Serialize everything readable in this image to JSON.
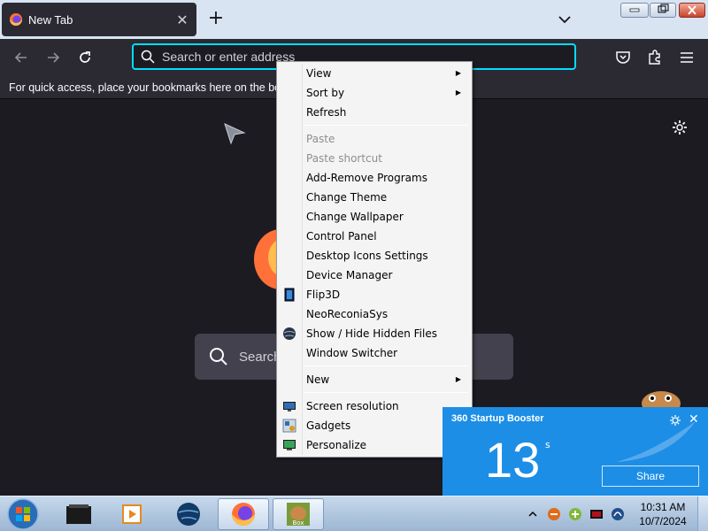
{
  "browser": {
    "tab": {
      "title": "New Tab",
      "favicon": "firefox-icon",
      "close_icon": "close-icon"
    },
    "new_tab_icon": "plus-icon",
    "tab_list_icon": "chevron-down-icon",
    "window_controls": [
      "minimize-icon",
      "maximize-icon",
      "close-icon"
    ],
    "nav": {
      "back_icon": "back-arrow-icon",
      "forward_icon": "forward-arrow-icon",
      "reload_icon": "reload-icon"
    },
    "urlbar": {
      "placeholder": "Search or enter address",
      "search_icon": "search-icon"
    },
    "toolbar_icons": [
      "pocket-icon",
      "extensions-icon",
      "menu-icon"
    ],
    "bookmarks_bar_text": "For quick access, place your bookmarks here on the bookmarks toolbar.",
    "content": {
      "search_placeholder": "Search",
      "settings_icon": "gear-icon"
    },
    "accent": "#00ddff"
  },
  "context_menu": {
    "items": [
      {
        "label": "View",
        "submenu": true,
        "enabled": true
      },
      {
        "label": "Sort by",
        "submenu": true,
        "enabled": true
      },
      {
        "label": "Refresh",
        "enabled": true
      },
      {
        "separator": true
      },
      {
        "label": "Paste",
        "enabled": false
      },
      {
        "label": "Paste shortcut",
        "enabled": false
      },
      {
        "label": "Add-Remove Programs",
        "enabled": true
      },
      {
        "label": "Change Theme",
        "enabled": true
      },
      {
        "label": "Change Wallpaper",
        "enabled": true
      },
      {
        "label": "Control Panel",
        "enabled": true
      },
      {
        "label": "Desktop Icons Settings",
        "enabled": true
      },
      {
        "label": "Device Manager",
        "enabled": true
      },
      {
        "label": "Flip3D",
        "enabled": true,
        "icon": "flip3d-icon"
      },
      {
        "label": "NeoReconiaSys",
        "enabled": true
      },
      {
        "label": "Show / Hide Hidden Files",
        "enabled": true,
        "icon": "globe-icon"
      },
      {
        "label": "Window Switcher",
        "enabled": true
      },
      {
        "separator": true
      },
      {
        "label": "New",
        "submenu": true,
        "enabled": true
      },
      {
        "separator": true
      },
      {
        "label": "Screen resolution",
        "enabled": true,
        "icon": "display-icon"
      },
      {
        "label": "Gadgets",
        "enabled": true,
        "icon": "gadgets-icon"
      },
      {
        "label": "Personalize",
        "enabled": true,
        "icon": "personalize-icon"
      }
    ]
  },
  "booster": {
    "title": "360 Startup Booster",
    "seconds": "13",
    "unit": "s",
    "share_label": "Share",
    "settings_icon": "gear-icon",
    "close_icon": "close-icon",
    "background": "#1d8ee6"
  },
  "taskbar": {
    "start_icon": "windows-start-icon",
    "apps": [
      "folder-app-icon",
      "media-player-icon",
      "globe-browser-icon",
      "firefox-icon",
      "box-app-icon"
    ],
    "tray_icons": [
      "tray-expand-icon",
      "tray-stop-icon",
      "tray-add-icon",
      "tray-monitor-icon",
      "tray-network-icon"
    ],
    "time": "10:31 AM",
    "date": "10/7/2024"
  }
}
